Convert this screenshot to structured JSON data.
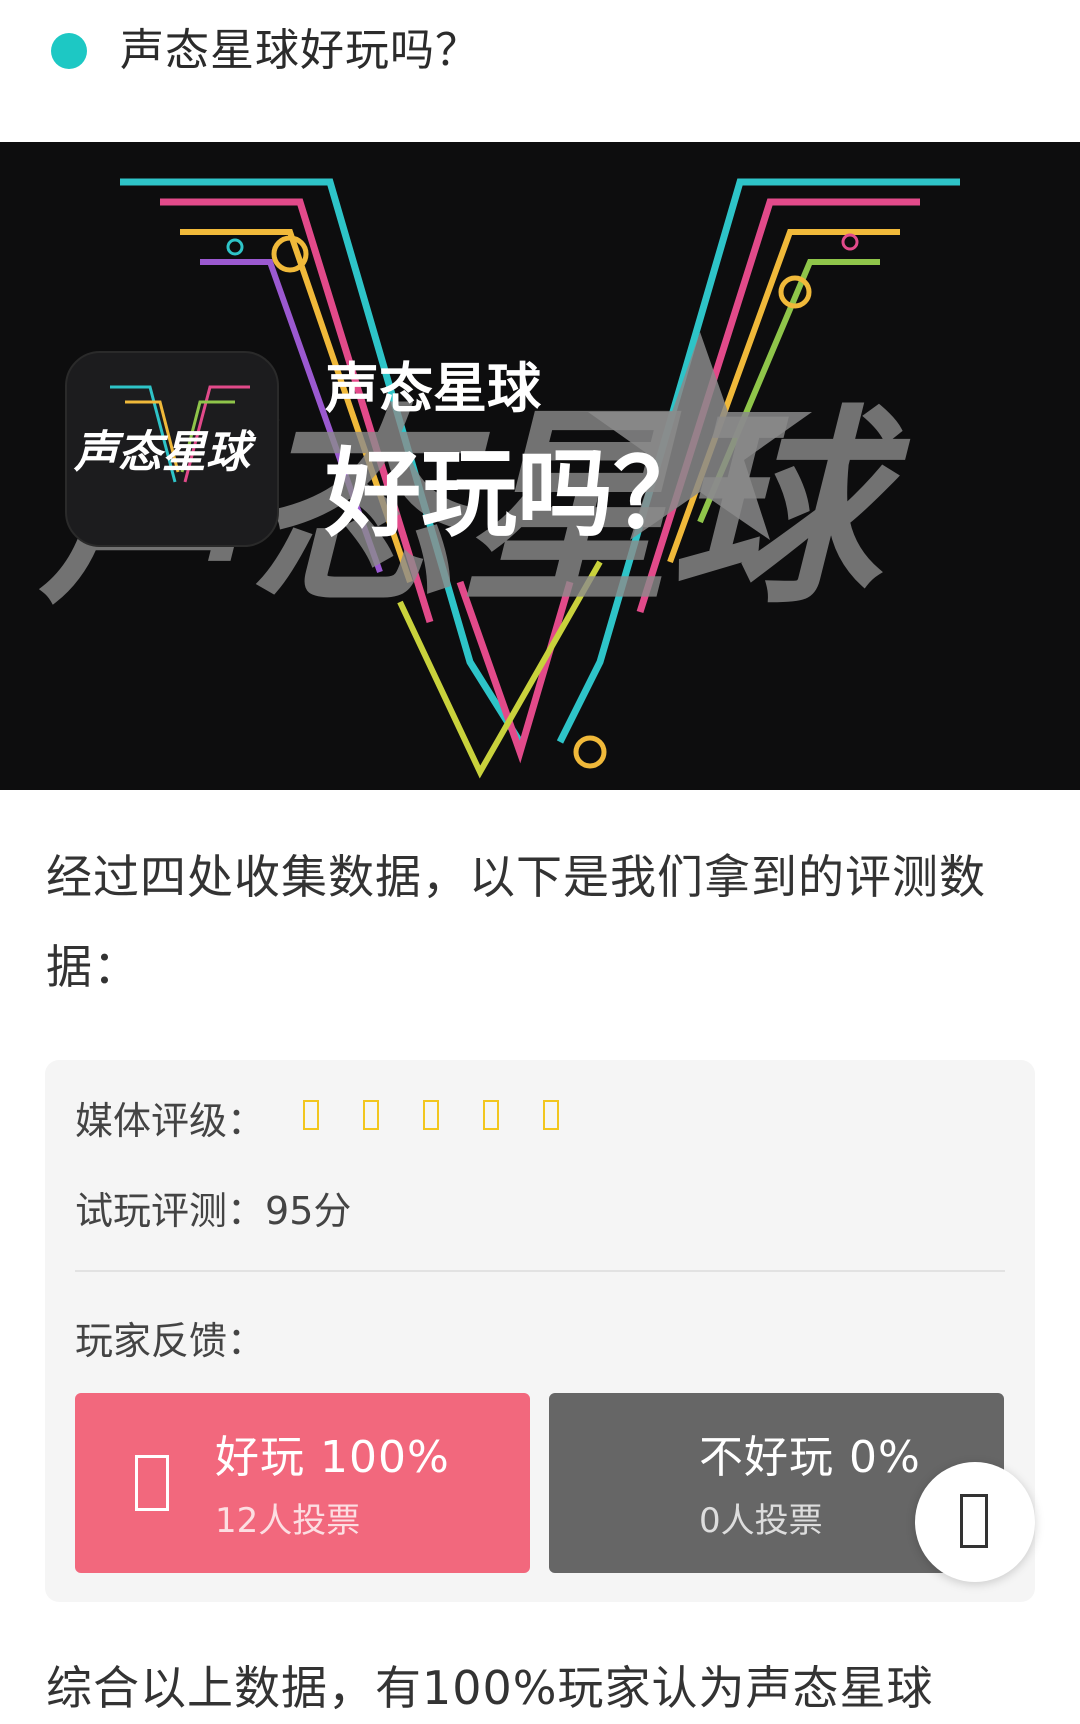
{
  "header": {
    "title": "声态星球好玩吗？",
    "dot_color": "#1dc8c4"
  },
  "banner": {
    "app_icon_text": "声态星球",
    "line1": "声态星球",
    "line2": "好玩吗？",
    "background_text": "声态星球"
  },
  "intro": {
    "text": "经过四处收集数据，以下是我们拿到的评测数据："
  },
  "rating_card": {
    "media_rating_label": "媒体评级：",
    "star_count": 5,
    "star_icon": "star-icon",
    "star_color": "#f2c61f",
    "trial_label": "试玩评测：",
    "trial_score": "95分",
    "feedback_label": "玩家反馈：",
    "good": {
      "label": "好玩 100%",
      "votes": "12人投票",
      "icon": "thumbs-up-icon",
      "color": "#f2687d"
    },
    "bad": {
      "label": "不好玩 0%",
      "votes": "0人投票",
      "color": "#666666"
    }
  },
  "floating_button": {
    "icon": "action-icon"
  },
  "conclusion": {
    "text": "综合以上数据，有100%玩家认为声态星球"
  }
}
